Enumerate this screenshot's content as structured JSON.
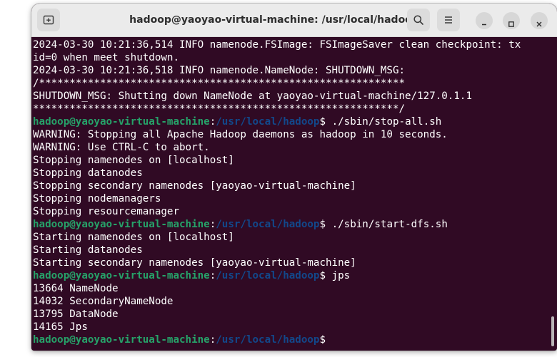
{
  "window": {
    "title": "hadoop@yaoyao-virtual-machine: /usr/local/hadoop"
  },
  "icons": {
    "new_tab": "new-tab-icon",
    "search": "search-icon",
    "menu": "hamburger-menu-icon",
    "minimize": "minimize-icon",
    "maximize": "maximize-icon",
    "close": "close-icon"
  },
  "colors": {
    "terminal_bg": "#300a24",
    "prompt_user": "#26a269",
    "prompt_path": "#12488b",
    "text": "#ffffff"
  },
  "terminal": {
    "prompt": {
      "user_host": "hadoop@yaoyao-virtual-machine",
      "colon": ":",
      "path": "/usr/local/hadoop",
      "symbol": "$"
    },
    "lines": [
      {
        "type": "output",
        "text": "2024-03-30 10:21:36,514 INFO namenode.FSImage: FSImageSaver clean checkpoint: tx"
      },
      {
        "type": "output",
        "text": "id=0 when meet shutdown."
      },
      {
        "type": "output",
        "text": "2024-03-30 10:21:36,518 INFO namenode.NameNode: SHUTDOWN_MSG:"
      },
      {
        "type": "output",
        "text": "/************************************************************"
      },
      {
        "type": "output",
        "text": "SHUTDOWN_MSG: Shutting down NameNode at yaoyao-virtual-machine/127.0.1.1"
      },
      {
        "type": "output",
        "text": "************************************************************/"
      },
      {
        "type": "prompt",
        "command": " ./sbin/stop-all.sh"
      },
      {
        "type": "output",
        "text": "WARNING: Stopping all Apache Hadoop daemons as hadoop in 10 seconds."
      },
      {
        "type": "output",
        "text": "WARNING: Use CTRL-C to abort."
      },
      {
        "type": "output",
        "text": "Stopping namenodes on [localhost]"
      },
      {
        "type": "output",
        "text": "Stopping datanodes"
      },
      {
        "type": "output",
        "text": "Stopping secondary namenodes [yaoyao-virtual-machine]"
      },
      {
        "type": "output",
        "text": "Stopping nodemanagers"
      },
      {
        "type": "output",
        "text": "Stopping resourcemanager"
      },
      {
        "type": "prompt",
        "command": " ./sbin/start-dfs.sh"
      },
      {
        "type": "output",
        "text": "Starting namenodes on [localhost]"
      },
      {
        "type": "output",
        "text": "Starting datanodes"
      },
      {
        "type": "output",
        "text": "Starting secondary namenodes [yaoyao-virtual-machine]"
      },
      {
        "type": "prompt",
        "command": " jps"
      },
      {
        "type": "output",
        "text": "13664 NameNode"
      },
      {
        "type": "output",
        "text": "14032 SecondaryNameNode"
      },
      {
        "type": "output",
        "text": "13795 DataNode"
      },
      {
        "type": "output",
        "text": "14165 Jps"
      },
      {
        "type": "prompt",
        "command": ""
      }
    ]
  }
}
